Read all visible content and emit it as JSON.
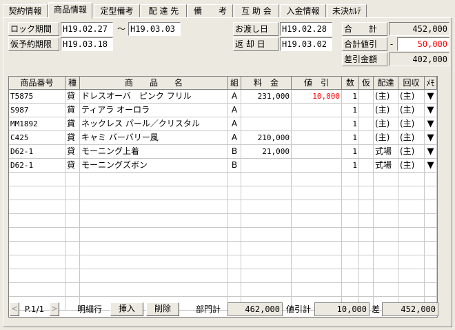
{
  "tabs": [
    "契約情報",
    "商品情報",
    "定型備考",
    "配 達 先",
    "備　　考",
    "互 助 会",
    "入金情報",
    "未決ｶﾙﾃ"
  ],
  "header": {
    "lock_period_label": "ロック期間",
    "lock_from": "H19.02.27",
    "tilde": "～",
    "lock_to": "H19.03.03",
    "prov_deadline_label": "仮予約期限",
    "prov_deadline": "H19.03.18",
    "handover_label": "お渡し日",
    "handover": "H19.02.28",
    "return_label": "返 却 日",
    "return_date": "H19.03.02",
    "total_label": "合　　計",
    "total": "452,000",
    "total_discount_label": "合計値引",
    "total_discount_sign": "-",
    "total_discount": "50,000",
    "net_label": "差引金額",
    "net": "402,000"
  },
  "columns": [
    "商品番号",
    "種",
    "商　　品　　名",
    "組",
    "料　金",
    "値　引",
    "数",
    "仮",
    "配達",
    "回収",
    "ﾒﾓ"
  ],
  "rows": [
    {
      "code": "T5875",
      "type": "貸",
      "name": "ドレスオーバ　ピンク フリル",
      "group": "A",
      "price": "231,000",
      "discount": "10,000",
      "qty": "1",
      "prov": "",
      "delivery": "(主)",
      "collect": "(主)",
      "memo": "▼"
    },
    {
      "code": "S987",
      "type": "貸",
      "name": "ティアラ オーロラ",
      "group": "A",
      "price": "",
      "discount": "",
      "qty": "1",
      "prov": "",
      "delivery": "(主)",
      "collect": "(主)",
      "memo": "▼"
    },
    {
      "code": "MM1892",
      "type": "貸",
      "name": "ネックレス パール／クリスタル",
      "group": "A",
      "price": "",
      "discount": "",
      "qty": "1",
      "prov": "",
      "delivery": "(主)",
      "collect": "(主)",
      "memo": "▼"
    },
    {
      "code": "C425",
      "type": "貸",
      "name": "キャミ バーバリー風",
      "group": "A",
      "price": "210,000",
      "discount": "",
      "qty": "1",
      "prov": "",
      "delivery": "(主)",
      "collect": "(主)",
      "memo": "▼"
    },
    {
      "code": "D62-1",
      "type": "貸",
      "name": "モーニング上着",
      "group": "B",
      "price": "21,000",
      "discount": "",
      "qty": "1",
      "prov": "",
      "delivery": "式場",
      "collect": "(主)",
      "memo": "▼"
    },
    {
      "code": "D62-1",
      "type": "貸",
      "name": "モーニングズボン",
      "group": "B",
      "price": "",
      "discount": "",
      "qty": "1",
      "prov": "",
      "delivery": "式場",
      "collect": "(主)",
      "memo": "▼"
    }
  ],
  "footer": {
    "prev": "<",
    "page": "P.1/1",
    "next": ">",
    "detail_label": "明細行",
    "insert": "挿入",
    "delete": "削除",
    "dept_total_label": "部門計",
    "dept_total": "462,000",
    "discount_total_label": "値引計",
    "discount_total": "10,000",
    "diff_label": "差",
    "diff": "452,000"
  }
}
